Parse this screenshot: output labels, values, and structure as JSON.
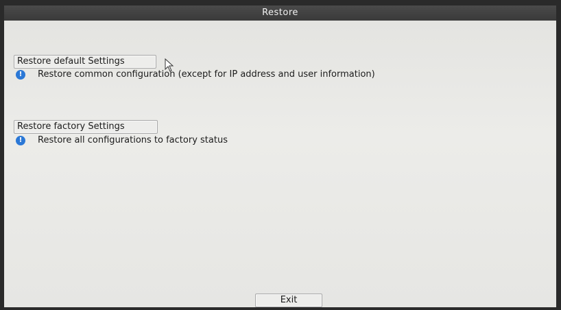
{
  "window": {
    "title": "Restore"
  },
  "sections": [
    {
      "button_label": "Restore default Settings",
      "description": "Restore common configuration (except for IP address and user information)",
      "icon": "info-icon"
    },
    {
      "button_label": "Restore factory Settings",
      "description": "Restore all configurations to factory status",
      "icon": "info-icon"
    }
  ],
  "footer": {
    "exit_label": "Exit"
  },
  "colors": {
    "title_bar": "#3f3f3f",
    "panel": "#e8e8e5",
    "info_icon": "#2b78d6"
  }
}
